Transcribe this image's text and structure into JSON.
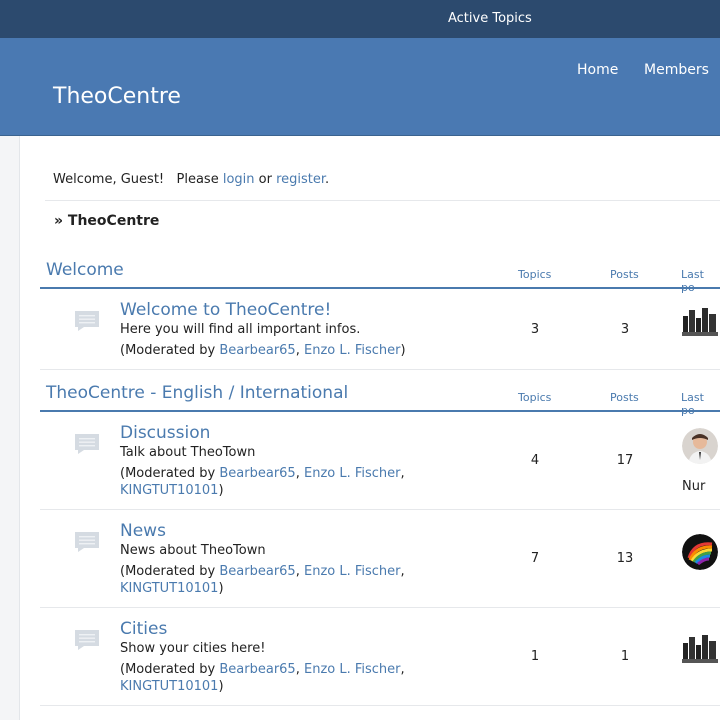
{
  "topbar": {
    "active_topics": "Active Topics"
  },
  "header": {
    "site_title": "TheoCentre",
    "nav": [
      {
        "label": "Home"
      },
      {
        "label": "Members"
      }
    ]
  },
  "welcome": {
    "text_before": "Welcome, Guest!   Please ",
    "login": "login",
    "or": " or ",
    "register": "register",
    "period": "."
  },
  "breadcrumb": {
    "label": "» TheoCentre"
  },
  "columns": {
    "topics": "Topics",
    "posts": "Posts",
    "last_post": "Last po"
  },
  "categories": [
    {
      "title": "Welcome",
      "forums": [
        {
          "name": "Welcome to TheoCentre!",
          "description": "Here you will find all important infos.",
          "mods_prefix": "(Moderated by ",
          "mods": [
            "Bearbear65",
            "Enzo L. Fischer"
          ],
          "mods_suffix": ")",
          "topics": "3",
          "posts": "3",
          "last_post_avatar": "skyline"
        }
      ]
    },
    {
      "title": "TheoCentre - English / International",
      "forums": [
        {
          "name": "Discussion",
          "description": "Talk about TheoTown",
          "mods_prefix": "(Moderated by ",
          "mods": [
            "Bearbear65",
            "Enzo L. Fischer",
            "KINGTUT10101"
          ],
          "mods_suffix": ")",
          "topics": "4",
          "posts": "17",
          "last_post_avatar": "person",
          "last_post_text": "Nur"
        },
        {
          "name": "News",
          "description": "News about TheoTown",
          "mods_prefix": "(Moderated by ",
          "mods": [
            "Bearbear65",
            "Enzo L. Fischer",
            "KINGTUT10101"
          ],
          "mods_suffix": ")",
          "topics": "7",
          "posts": "13",
          "last_post_avatar": "rainbow"
        },
        {
          "name": "Cities",
          "description": "Show your cities here!",
          "mods_prefix": "(Moderated by ",
          "mods": [
            "Bearbear65",
            "Enzo L. Fischer",
            "KINGTUT10101"
          ],
          "mods_suffix": ")",
          "topics": "1",
          "posts": "1",
          "last_post_avatar": "skyline"
        }
      ]
    }
  ]
}
